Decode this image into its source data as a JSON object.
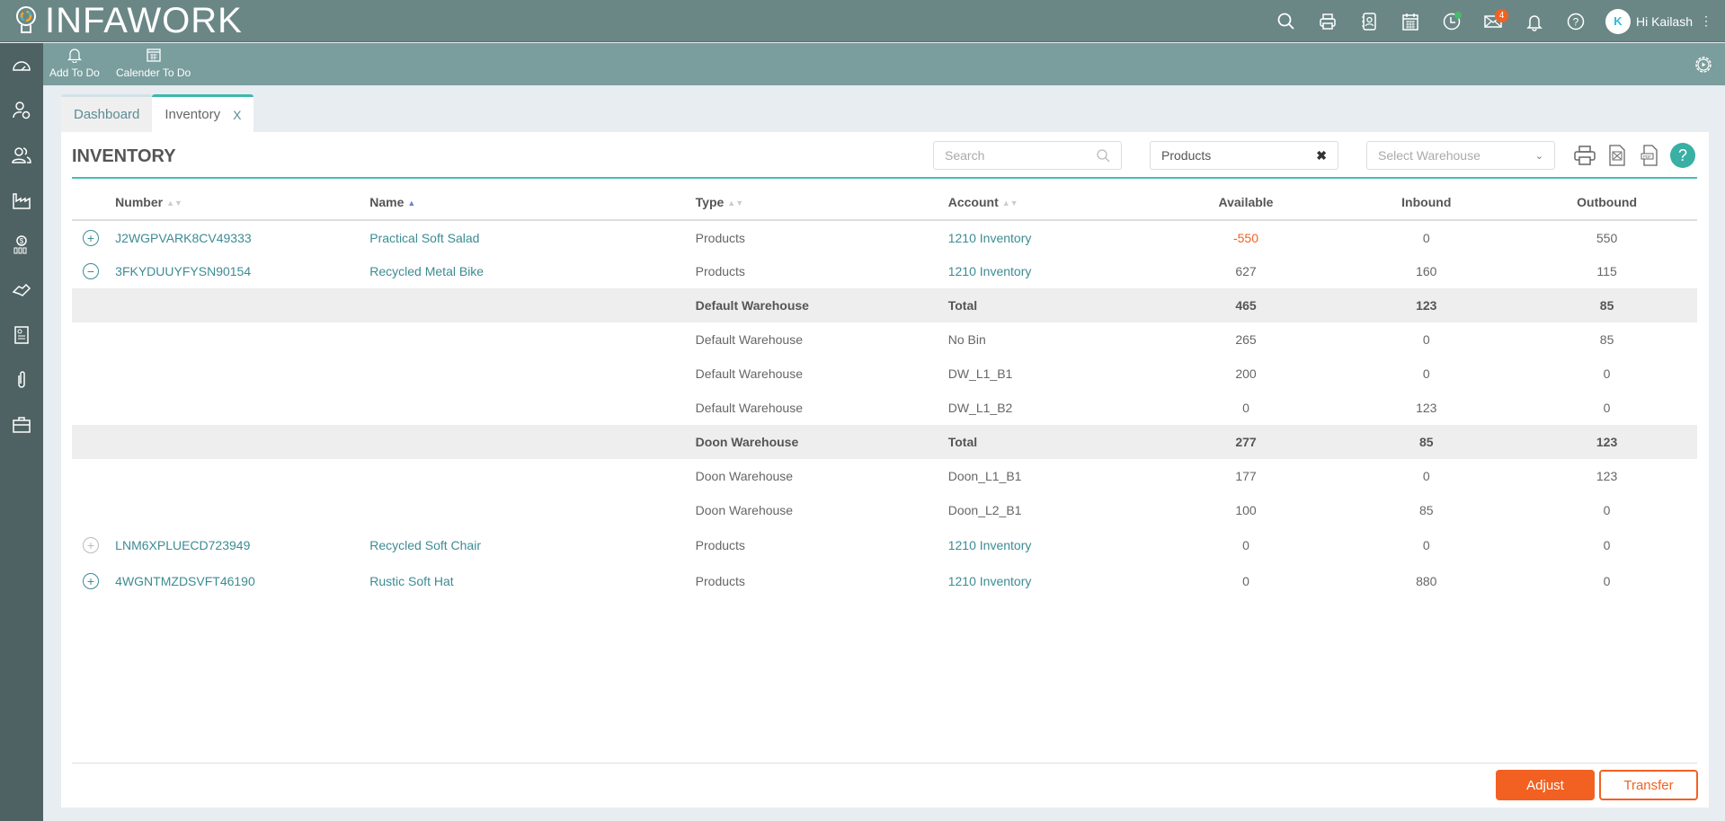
{
  "app": {
    "brand": "INFAWORK"
  },
  "topbar": {
    "icons": [
      "search-icon",
      "print-icon",
      "contacts-icon",
      "calendar-icon",
      "clock-icon",
      "mail-icon",
      "bell-icon",
      "help-icon"
    ],
    "mail_badge": "4",
    "user_initial": "K",
    "user_greeting": "Hi Kailash"
  },
  "subbar": {
    "add_todo": "Add To Do",
    "calendar_todo": "Calender To Do"
  },
  "sidebar": {
    "items": [
      "dashboard",
      "user-settings",
      "contacts",
      "manufacturing",
      "finance",
      "deals",
      "reports",
      "attachments",
      "jobs"
    ]
  },
  "tabs": [
    {
      "label": "Dashboard",
      "active": false
    },
    {
      "label": "Inventory",
      "active": true,
      "close": "X"
    }
  ],
  "page": {
    "title": "INVENTORY",
    "search_placeholder": "Search",
    "type_filter": "Products",
    "warehouse_placeholder": "Select Warehouse"
  },
  "table": {
    "headers": [
      "Number",
      "Name",
      "Type",
      "Account",
      "Available",
      "Inbound",
      "Outbound"
    ],
    "rows": [
      {
        "kind": "item",
        "expander": "+",
        "number": "J2WGPVARK8CV49333",
        "name": "Practical Soft Salad",
        "type": "Products",
        "account": "1210 Inventory",
        "available": "-550",
        "inbound": "0",
        "outbound": "550"
      },
      {
        "kind": "item",
        "expander": "−",
        "number": "3FKYDUUYFYSN90154",
        "name": "Recycled Metal Bike",
        "type": "Products",
        "account": "1210 Inventory",
        "available": "627",
        "inbound": "160",
        "outbound": "115"
      },
      {
        "kind": "sub",
        "type": "Default Warehouse",
        "account": "Total",
        "available": "465",
        "inbound": "123",
        "outbound": "85"
      },
      {
        "kind": "bin",
        "type": "Default Warehouse",
        "account": "No Bin",
        "available": "265",
        "inbound": "0",
        "outbound": "85"
      },
      {
        "kind": "bin",
        "type": "Default Warehouse",
        "account": "DW_L1_B1",
        "available": "200",
        "inbound": "0",
        "outbound": "0"
      },
      {
        "kind": "bin",
        "type": "Default Warehouse",
        "account": "DW_L1_B2",
        "available": "0",
        "inbound": "123",
        "outbound": "0"
      },
      {
        "kind": "sub",
        "type": "Doon Warehouse",
        "account": "Total",
        "available": "277",
        "inbound": "85",
        "outbound": "123"
      },
      {
        "kind": "bin",
        "type": "Doon Warehouse",
        "account": "Doon_L1_B1",
        "available": "177",
        "inbound": "0",
        "outbound": "123"
      },
      {
        "kind": "bin",
        "type": "Doon Warehouse",
        "account": "Doon_L2_B1",
        "available": "100",
        "inbound": "85",
        "outbound": "0"
      },
      {
        "kind": "item",
        "expander": "+",
        "number": "LNM6XPLUECD723949",
        "name": "Recycled Soft Chair",
        "type": "Products",
        "account": "1210 Inventory",
        "available": "0",
        "inbound": "0",
        "outbound": "0"
      },
      {
        "kind": "item",
        "expander": "+",
        "number": "4WGNTMZDSVFT46190",
        "name": "Rustic Soft Hat",
        "type": "Products",
        "account": "1210 Inventory",
        "available": "0",
        "inbound": "880",
        "outbound": "0"
      }
    ]
  },
  "buttons": {
    "adjust": "Adjust",
    "transfer": "Transfer"
  },
  "colors": {
    "accent": "#f26122",
    "teal": "#3aafa4",
    "topbar": "#6a8786",
    "sidebar": "#4f6263"
  }
}
